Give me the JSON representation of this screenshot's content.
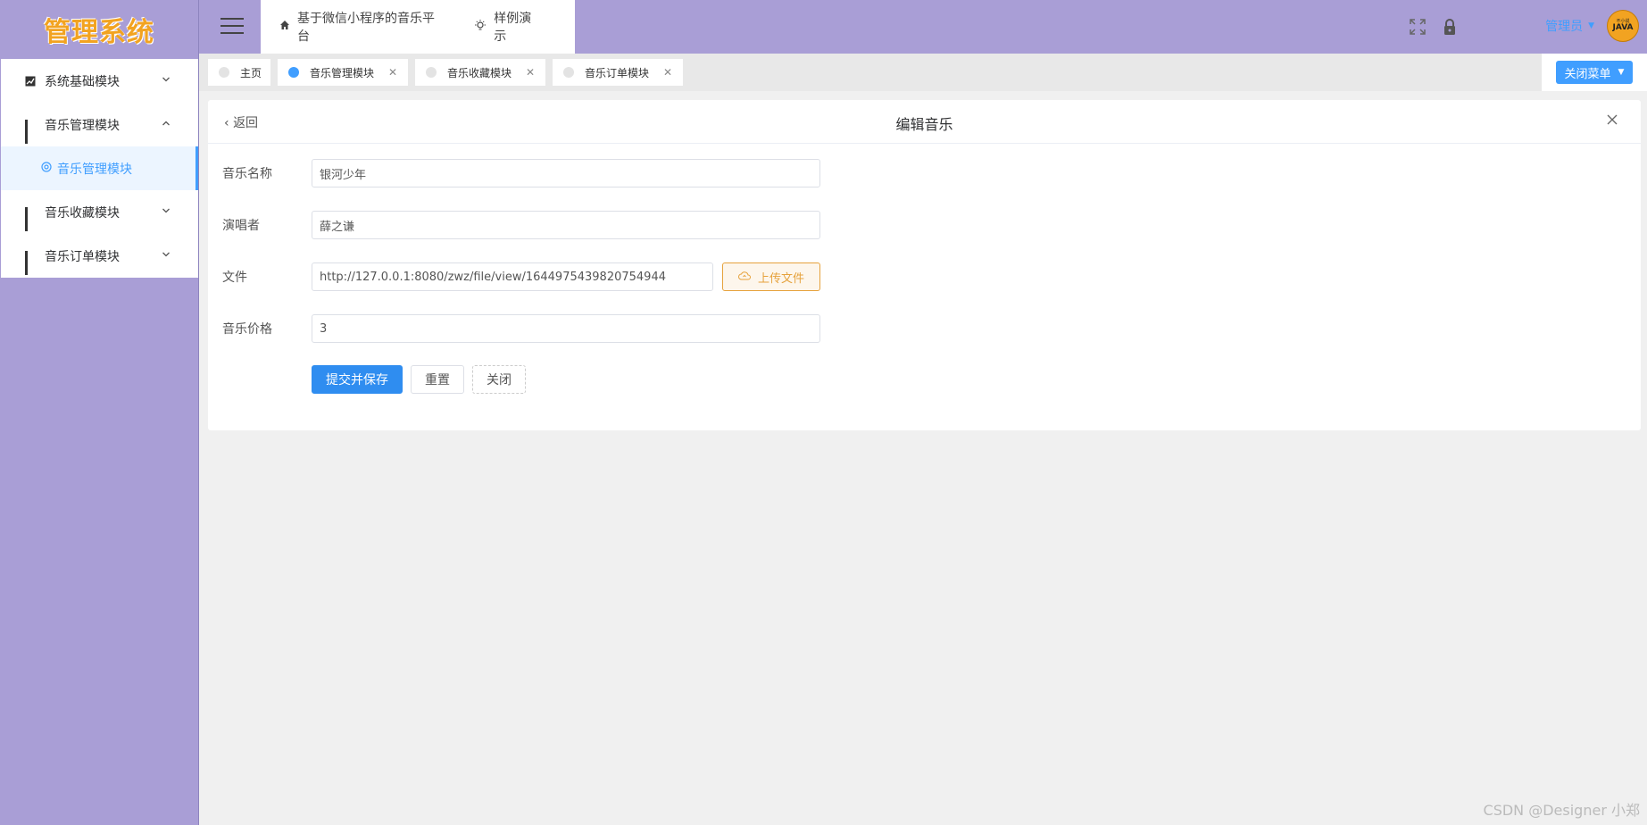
{
  "brand": {
    "logo_text": "管理系统"
  },
  "sidebar": {
    "items": [
      {
        "label": "系统基础模块",
        "expanded": false
      },
      {
        "label": "音乐管理模块",
        "expanded": true
      },
      {
        "label": "音乐管理模块",
        "is_sub": true,
        "active": true
      },
      {
        "label": "音乐收藏模块",
        "expanded": false
      },
      {
        "label": "音乐订单模块",
        "expanded": false
      }
    ]
  },
  "header": {
    "nav": [
      {
        "label": "基于微信小程序的音乐平台",
        "icon": "home-icon"
      },
      {
        "label": "样例演示",
        "icon": "bulb-icon"
      }
    ],
    "user": {
      "name": "管理员",
      "avatar_text": "JAVA",
      "avatar_small": "不小说"
    }
  },
  "tabs": [
    {
      "label": "主页",
      "closable": false,
      "active": false
    },
    {
      "label": "音乐管理模块",
      "closable": true,
      "active": true
    },
    {
      "label": "音乐收藏模块",
      "closable": true,
      "active": false
    },
    {
      "label": "音乐订单模块",
      "closable": true,
      "active": false
    }
  ],
  "close_menu": {
    "label": "关闭菜单"
  },
  "card": {
    "back_label": "返回",
    "title": "编辑音乐"
  },
  "form": {
    "name_label": "音乐名称",
    "name_value": "银河少年",
    "singer_label": "演唱者",
    "singer_value": "薛之谦",
    "file_label": "文件",
    "file_value": "http://127.0.0.1:8080/zwz/file/view/1644975439820754944",
    "upload_label": "上传文件",
    "price_label": "音乐价格",
    "price_value": "3"
  },
  "buttons": {
    "submit": "提交并保存",
    "reset": "重置",
    "close": "关闭"
  },
  "watermark": "CSDN @Designer 小郑",
  "colors": {
    "header_bg": "#a99ed6",
    "primary": "#409eff",
    "warning": "#e6a23c",
    "logo": "#f2a321"
  }
}
